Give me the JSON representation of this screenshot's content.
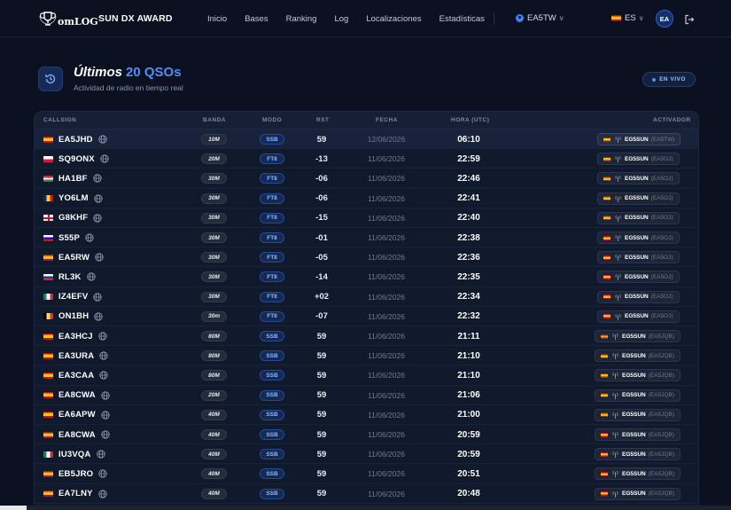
{
  "nav": {
    "logo_text": "omLOG",
    "app_title": "SUN DX AWARD",
    "menu": [
      "Inicio",
      "Bases",
      "Ranking",
      "Log",
      "Localizaciones",
      "Estadísticas"
    ],
    "user_callsign": "EA5TW",
    "language": "ES",
    "avatar_initials": "EA"
  },
  "header": {
    "title_main": "Últimos",
    "title_accent": "20 QSOs",
    "subtitle": "Actividad de radio en tiempo real",
    "live_badge": "EN VIVO"
  },
  "table": {
    "columns": {
      "callsign": "CALLSIGN",
      "band": "BANDA",
      "mode": "MODO",
      "rst": "RST",
      "date": "FECHA",
      "time": "HORA (UTC)",
      "activator": "ACTIVADOR"
    },
    "rows": [
      {
        "flag": "es",
        "callsign": "EA5JHD",
        "band": "10M",
        "mode": "SSB",
        "rst": "59",
        "date": "12/06/2026",
        "time": "06:10",
        "activator": "EG5SUN",
        "operator": "(EA5TW)"
      },
      {
        "flag": "pl",
        "callsign": "SQ9ONX",
        "band": "20M",
        "mode": "FT8",
        "rst": "-13",
        "date": "11/06/2026",
        "time": "22:59",
        "activator": "EG5SUN",
        "operator": "(EA5OJ)"
      },
      {
        "flag": "hu",
        "callsign": "HA1BF",
        "band": "30M",
        "mode": "FT8",
        "rst": "-06",
        "date": "11/06/2026",
        "time": "22:46",
        "activator": "EG5SUN",
        "operator": "(EA5OJ)"
      },
      {
        "flag": "ro",
        "callsign": "YO6LM",
        "band": "30M",
        "mode": "FT8",
        "rst": "-06",
        "date": "11/06/2026",
        "time": "22:41",
        "activator": "EG5SUN",
        "operator": "(EA5OJ)"
      },
      {
        "flag": "gb",
        "callsign": "G8KHF",
        "band": "30M",
        "mode": "FT8",
        "rst": "-15",
        "date": "11/06/2026",
        "time": "22:40",
        "activator": "EG5SUN",
        "operator": "(EA5OJ)"
      },
      {
        "flag": "si",
        "callsign": "S55P",
        "band": "30M",
        "mode": "FT8",
        "rst": "-01",
        "date": "11/06/2026",
        "time": "22:38",
        "activator": "EG5SUN",
        "operator": "(EA5OJ)"
      },
      {
        "flag": "es",
        "callsign": "EA5RW",
        "band": "30M",
        "mode": "FT8",
        "rst": "-05",
        "date": "11/06/2026",
        "time": "22:36",
        "activator": "EG5SUN",
        "operator": "(EA5OJ)"
      },
      {
        "flag": "ru",
        "callsign": "RL3K",
        "band": "30M",
        "mode": "FT8",
        "rst": "-14",
        "date": "11/06/2026",
        "time": "22:35",
        "activator": "EG5SUN",
        "operator": "(EA5OJ)"
      },
      {
        "flag": "it",
        "callsign": "IZ4EFV",
        "band": "30M",
        "mode": "FT8",
        "rst": "+02",
        "date": "11/06/2026",
        "time": "22:34",
        "activator": "EG5SUN",
        "operator": "(EA5OJ)"
      },
      {
        "flag": "be",
        "callsign": "ON1BH",
        "band": "30m",
        "mode": "FT8",
        "rst": "-07",
        "date": "11/06/2026",
        "time": "22:32",
        "activator": "EG5SUN",
        "operator": "(EA5OJ)"
      },
      {
        "flag": "es",
        "callsign": "EA3HCJ",
        "band": "80M",
        "mode": "SSB",
        "rst": "59",
        "date": "11/06/2026",
        "time": "21:11",
        "activator": "EG5SUN",
        "operator": "(EA5JQB)"
      },
      {
        "flag": "es",
        "callsign": "EA3URA",
        "band": "80M",
        "mode": "SSB",
        "rst": "59",
        "date": "11/06/2026",
        "time": "21:10",
        "activator": "EG5SUN",
        "operator": "(EA5JQB)"
      },
      {
        "flag": "es",
        "callsign": "EA3CAA",
        "band": "80M",
        "mode": "SSB",
        "rst": "59",
        "date": "11/06/2026",
        "time": "21:10",
        "activator": "EG5SUN",
        "operator": "(EA5JQB)"
      },
      {
        "flag": "es",
        "callsign": "EA8CWA",
        "band": "20M",
        "mode": "SSB",
        "rst": "59",
        "date": "11/06/2026",
        "time": "21:06",
        "activator": "EG5SUN",
        "operator": "(EA5JQB)"
      },
      {
        "flag": "es",
        "callsign": "EA6APW",
        "band": "40M",
        "mode": "SSB",
        "rst": "59",
        "date": "11/06/2026",
        "time": "21:00",
        "activator": "EG5SUN",
        "operator": "(EA5JQB)"
      },
      {
        "flag": "es",
        "callsign": "EA8CWA",
        "band": "40M",
        "mode": "SSB",
        "rst": "59",
        "date": "11/06/2026",
        "time": "20:59",
        "activator": "EG5SUN",
        "operator": "(EA5JQB)"
      },
      {
        "flag": "it",
        "callsign": "IU3VQA",
        "band": "40M",
        "mode": "SSB",
        "rst": "59",
        "date": "11/06/2026",
        "time": "20:59",
        "activator": "EG5SUN",
        "operator": "(EA5JQB)"
      },
      {
        "flag": "es",
        "callsign": "EB5JRO",
        "band": "40M",
        "mode": "SSB",
        "rst": "59",
        "date": "11/06/2026",
        "time": "20:51",
        "activator": "EG5SUN",
        "operator": "(EA5JQB)"
      },
      {
        "flag": "es",
        "callsign": "EA7LNY",
        "band": "40M",
        "mode": "SSB",
        "rst": "59",
        "date": "11/06/2026",
        "time": "20:48",
        "activator": "EG5SUN",
        "operator": "(EA5JQB)"
      }
    ]
  }
}
